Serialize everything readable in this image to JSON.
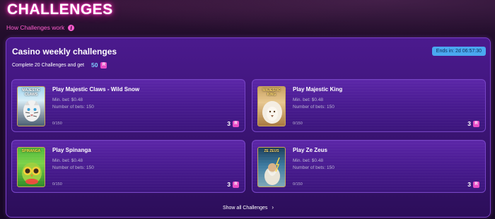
{
  "header": {
    "title": "CHALLENGES",
    "how_link": "How Challenges work",
    "info_symbol": "i"
  },
  "panel": {
    "title": "Casino weekly challenges",
    "subtitle": "Complete 20 Challenges and get",
    "reward_total": "50",
    "coin_symbol": "R",
    "timer": "Ends in: 2d 06:57:30"
  },
  "cards": [
    {
      "title": "Play Majestic Claws - Wild Snow",
      "min_bet": "Min. bet: $0.48",
      "bets": "Number of bets: 150",
      "progress": "0/150",
      "reward": "3",
      "thumb_text": "MAJESTIC CLAWS"
    },
    {
      "title": "Play Majestic King",
      "min_bet": "Min. bet: $0.48",
      "bets": "Number of bets: 150",
      "progress": "0/150",
      "reward": "3",
      "thumb_text": "MAJESTIC KING"
    },
    {
      "title": "Play Spinanga",
      "min_bet": "Min. bet: $0.48",
      "bets": "Number of bets: 150",
      "progress": "0/150",
      "reward": "3",
      "thumb_text": "SPINANGA"
    },
    {
      "title": "Play Ze Zeus",
      "min_bet": "Min. bet: $0.48",
      "bets": "Number of bets: 150",
      "progress": "0/150",
      "reward": "3",
      "thumb_text": "ZE ZEUS"
    }
  ],
  "footer": {
    "show_all": "Show all Challenges"
  },
  "colors": {
    "accent_pink": "#ff5ccf",
    "timer_blue": "#4aa8f0",
    "panel_purple": "#4b1a8e"
  }
}
